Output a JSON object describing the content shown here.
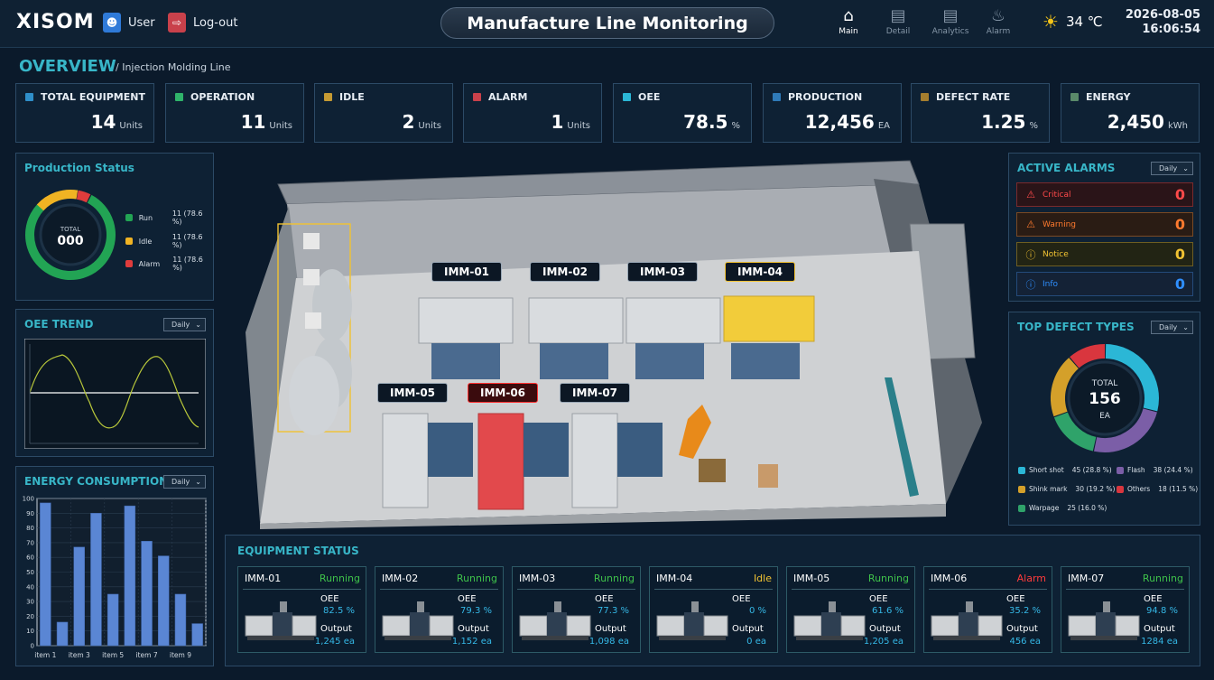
{
  "header": {
    "logo": "XISOM",
    "user_label": "User",
    "logout_label": "Log-out",
    "title": "Manufacture Line Monitoring",
    "nav": [
      {
        "label": "Main",
        "icon": "home-icon"
      },
      {
        "label": "Detail",
        "icon": "document-icon"
      },
      {
        "label": "Analytics",
        "icon": "bar-chart-icon"
      },
      {
        "label": "Alarm",
        "icon": "bell-icon"
      }
    ],
    "temperature": "34 ℃",
    "date": "2026-08-05",
    "time": "16:06:54"
  },
  "overview": {
    "title": "OVERVIEW",
    "subtitle": "/ Injection Molding Line",
    "kpis": [
      {
        "label": "TOTAL EQUIPMENT",
        "value": "14",
        "unit": "Units",
        "color": "#2f8fc9"
      },
      {
        "label": "OPERATION",
        "value": "11",
        "unit": "Units",
        "color": "#2fb36a"
      },
      {
        "label": "IDLE",
        "value": "2",
        "unit": "Units",
        "color": "#c59a33"
      },
      {
        "label": "ALARM",
        "value": "1",
        "unit": "Units",
        "color": "#c9414b"
      },
      {
        "label": "OEE",
        "value": "78.5",
        "unit": "%",
        "color": "#2bb7d6"
      },
      {
        "label": "PRODUCTION",
        "value": "12,456",
        "unit": "EA",
        "color": "#2f7ab8"
      },
      {
        "label": "DEFECT RATE",
        "value": "1.25",
        "unit": "%",
        "color": "#a57e2e"
      },
      {
        "label": "ENERGY",
        "value": "2,450",
        "unit": "kWh",
        "color": "#5a8a6a"
      }
    ]
  },
  "production_status": {
    "title": "Production Status",
    "total_label": "TOTAL",
    "total_value": "000",
    "legend": [
      {
        "label": "Run",
        "value": "11 (78.6 %)",
        "color": "#22a454"
      },
      {
        "label": "Idle",
        "value": "11 (78.6 %)",
        "color": "#f0b323"
      },
      {
        "label": "Alarm",
        "value": "11 (78.6 %)",
        "color": "#e03c3c"
      }
    ]
  },
  "oee_trend": {
    "title": "OEE TREND",
    "period": "Daily"
  },
  "energy": {
    "title": "ENERGY CONSUMPTION",
    "period": "Daily"
  },
  "chart_data": {
    "type": "bar",
    "categories": [
      "item 1",
      "item 2",
      "item 3",
      "item 4",
      "item 5",
      "item 6",
      "item 7",
      "item 8",
      "item 9",
      "item 10"
    ],
    "visible_tick_labels": [
      "item 1",
      "item 3",
      "item 5",
      "item 7",
      "item 9"
    ],
    "values": [
      97,
      16,
      67,
      90,
      35,
      95,
      71,
      61,
      35,
      15
    ],
    "ylim": [
      0,
      100
    ],
    "yticks": [
      "0",
      "10",
      "20",
      "30",
      "40",
      "50",
      "60",
      "70",
      "80",
      "90",
      "100"
    ],
    "grid": true,
    "bar_color": "#5a86d4"
  },
  "factory": {
    "tags": [
      {
        "label": "IMM-01",
        "state": "normal"
      },
      {
        "label": "IMM-02",
        "state": "normal"
      },
      {
        "label": "IMM-03",
        "state": "normal"
      },
      {
        "label": "IMM-04",
        "state": "idle"
      },
      {
        "label": "IMM-05",
        "state": "normal"
      },
      {
        "label": "IMM-06",
        "state": "alarm"
      },
      {
        "label": "IMM-07",
        "state": "normal"
      }
    ]
  },
  "alarms": {
    "title": "ACTIVE ALARMS",
    "period": "Daily",
    "items": [
      {
        "label": "Critical",
        "count": "0",
        "color": "#ff4a4a",
        "icon": "warning-triangle-icon"
      },
      {
        "label": "Warning",
        "count": "0",
        "color": "#ff7a2e",
        "icon": "warning-triangle-icon"
      },
      {
        "label": "Notice",
        "count": "0",
        "color": "#f1c232",
        "icon": "exclamation-circle-icon"
      },
      {
        "label": "Info",
        "count": "0",
        "color": "#2f8fff",
        "icon": "info-circle-icon"
      }
    ]
  },
  "defects": {
    "title": "TOP DEFECT TYPES",
    "period": "Daily",
    "total_label": "TOTAL",
    "total_value": "156",
    "total_unit": "EA",
    "legend": [
      {
        "label": "Short shot",
        "value": "45 (28.8 %)",
        "color": "#2bb7d6",
        "count": 45
      },
      {
        "label": "Flash",
        "value": "38 (24.4 %)",
        "color": "#7b5ea7",
        "count": 38
      },
      {
        "label": "Shink mark",
        "value": "30 (19.2 %)",
        "color": "#d4a02a",
        "count": 30
      },
      {
        "label": "Others",
        "value": "18 (11.5 %)",
        "color": "#d9363e",
        "count": 18
      },
      {
        "label": "Warpage",
        "value": "25 (16.0 %)",
        "color": "#2fa36a",
        "count": 25
      }
    ]
  },
  "equipment": {
    "title": "EQUIPMENT STATUS",
    "oee_label": "OEE",
    "output_label": "Output",
    "cards": [
      {
        "name": "IMM-01",
        "status": "Running",
        "status_color": "#3fc24a",
        "oee": "82.5 %",
        "output": "1,245 ea"
      },
      {
        "name": "IMM-02",
        "status": "Running",
        "status_color": "#3fc24a",
        "oee": "79.3 %",
        "output": "1,152 ea"
      },
      {
        "name": "IMM-03",
        "status": "Running",
        "status_color": "#3fc24a",
        "oee": "77.3 %",
        "output": "1,098 ea"
      },
      {
        "name": "IMM-04",
        "status": "Idle",
        "status_color": "#f1c232",
        "oee": "0 %",
        "output": "0 ea"
      },
      {
        "name": "IMM-05",
        "status": "Running",
        "status_color": "#3fc24a",
        "oee": "61.6 %",
        "output": "1,205 ea"
      },
      {
        "name": "IMM-06",
        "status": "Alarm",
        "status_color": "#ff3b3b",
        "oee": "35.2 %",
        "output": "456 ea"
      },
      {
        "name": "IMM-07",
        "status": "Running",
        "status_color": "#3fc24a",
        "oee": "94.8 %",
        "output": "1284 ea"
      }
    ]
  }
}
